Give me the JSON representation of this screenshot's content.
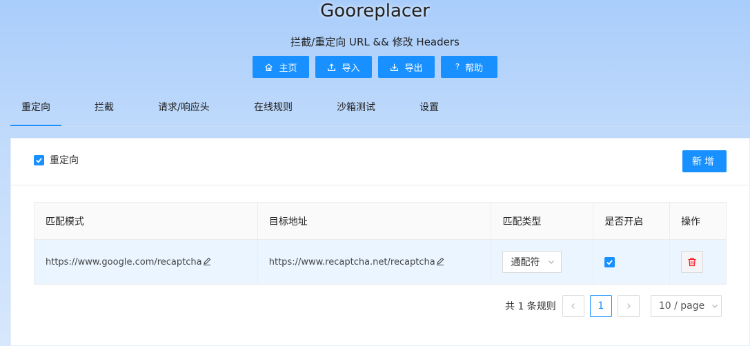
{
  "header": {
    "title": "Gooreplacer",
    "subtitle": "拦截/重定向 URL && 修改 Headers",
    "buttons": [
      {
        "label": "主页",
        "icon": "home-icon"
      },
      {
        "label": "导入",
        "icon": "upload-icon"
      },
      {
        "label": "导出",
        "icon": "download-icon"
      },
      {
        "label": "帮助",
        "icon": "question-icon"
      }
    ]
  },
  "tabs": [
    "重定向",
    "拦截",
    "请求/响应头",
    "在线规则",
    "沙箱测试",
    "设置"
  ],
  "active_tab": "重定向",
  "panel": {
    "toggle_label": "重定向",
    "toggle_checked": true,
    "add_label": "新增"
  },
  "table": {
    "columns": [
      "匹配模式",
      "目标地址",
      "匹配类型",
      "是否开启",
      "操作"
    ],
    "rows": [
      {
        "pattern": "https://www.google.com/recaptcha",
        "target": "https://www.recaptcha.net/recaptcha",
        "match_type": "通配符",
        "enabled": true
      }
    ]
  },
  "pagination": {
    "total_text": "共 1 条规则",
    "current_page": "1",
    "page_size": "10 / page"
  },
  "colors": {
    "accent": "#1890ff",
    "row_highlight": "#eaf5ff",
    "delete": "#f5222d"
  }
}
